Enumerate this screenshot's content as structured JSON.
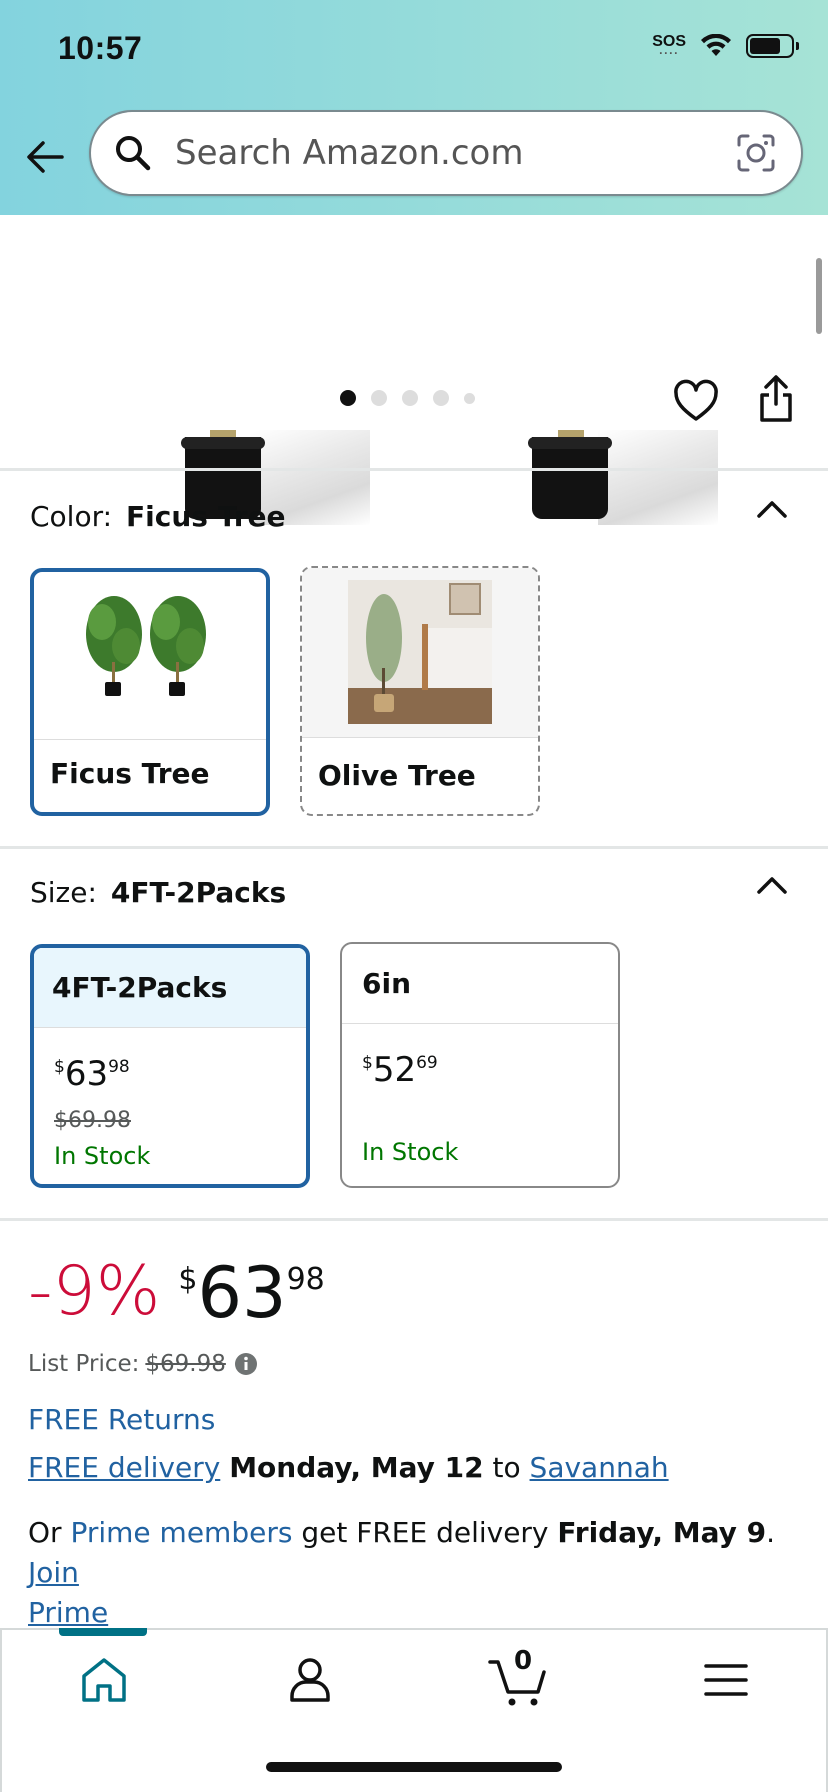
{
  "status_bar": {
    "time": "10:57",
    "sos": "SOS"
  },
  "search": {
    "placeholder": "Search Amazon.com"
  },
  "gallery": {
    "dots": 5,
    "active_dot": 0
  },
  "color_section": {
    "label": "Color:",
    "selected": "Ficus Tree",
    "options": [
      {
        "name": "Ficus Tree"
      },
      {
        "name": "Olive Tree"
      }
    ]
  },
  "size_section": {
    "label": "Size:",
    "selected": "4FT-2Packs",
    "options": [
      {
        "name": "4FT-2Packs",
        "price_symbol": "$",
        "price_whole": "63",
        "price_cents": "98",
        "list_price": "$69.98",
        "stock": "In Stock"
      },
      {
        "name": "6in",
        "price_symbol": "$",
        "price_whole": "52",
        "price_cents": "69",
        "stock": "In Stock"
      }
    ]
  },
  "price": {
    "discount": "-9%",
    "symbol": "$",
    "whole": "63",
    "cents": "98",
    "list_price_label": "List Price:",
    "list_price": "$69.98"
  },
  "returns": "FREE Returns",
  "delivery": {
    "link": "FREE delivery",
    "date": "Monday, May 12",
    "to": "to",
    "location": "Savannah"
  },
  "prime": {
    "prefix": "Or",
    "members": "Prime members",
    "middle": "get FREE delivery",
    "date": "Friday, May 9",
    "period": ".",
    "join_1": "Join",
    "join_2": "Prime"
  },
  "cart": {
    "count": "0"
  },
  "colors": {
    "accent_blue": "#2162a1",
    "discount_red": "#cc0c39",
    "stock_green": "#007600",
    "nav_teal": "#007185"
  }
}
